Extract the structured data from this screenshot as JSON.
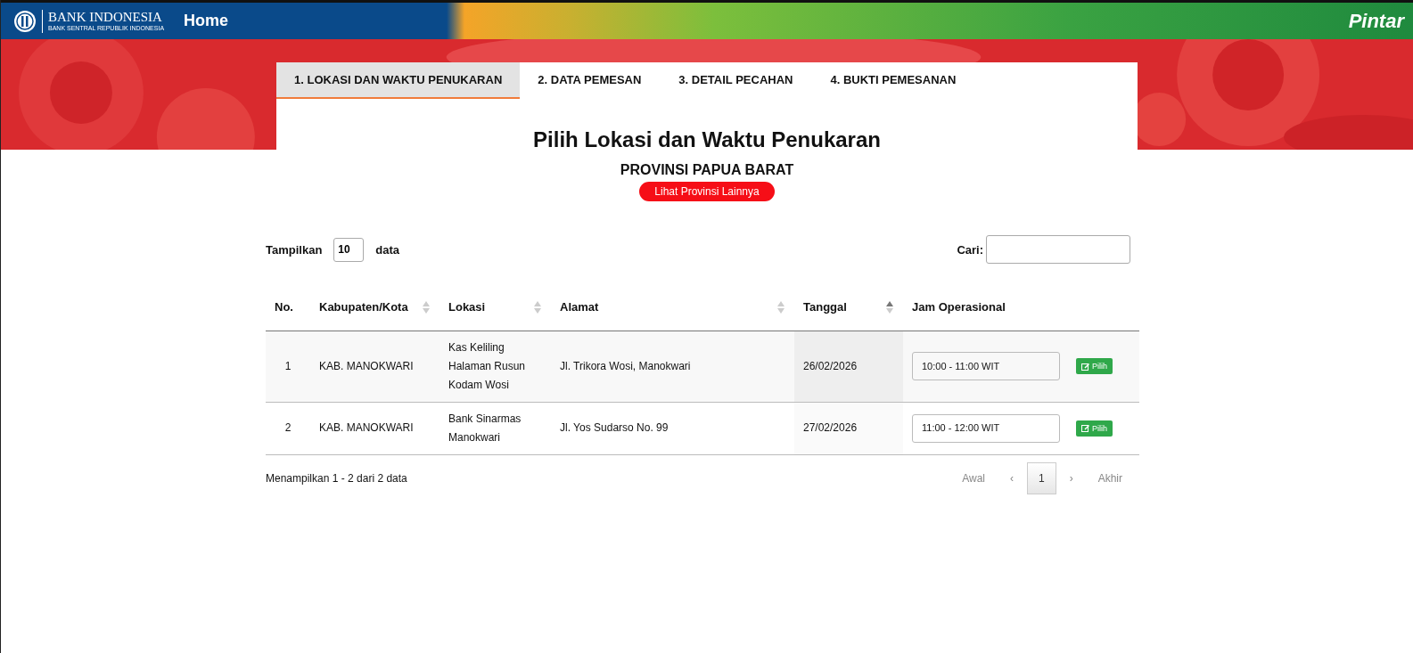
{
  "header": {
    "logo_title": "BANK INDONESIA",
    "logo_subtitle": "BANK SENTRAL REPUBLIK INDONESIA",
    "nav_home": "Home",
    "brand": "Pintar"
  },
  "steps": [
    {
      "label": "1. LOKASI DAN WAKTU PENUKARAN",
      "selected": true
    },
    {
      "label": "2. DATA PEMESAN",
      "selected": false
    },
    {
      "label": "3. DETAIL PECAHAN",
      "selected": false
    },
    {
      "label": "4. BUKTI PEMESANAN",
      "selected": false
    }
  ],
  "title": "Pilih Lokasi dan Waktu Penukaran",
  "province": "PROVINSI PAPUA BARAT",
  "other_province_button": "Lihat Provinsi Lainnya",
  "length_control": {
    "label_before": "Tampilkan",
    "value": "10",
    "label_after": "data"
  },
  "search": {
    "label": "Cari:"
  },
  "table": {
    "columns": [
      {
        "label": "No.",
        "sortable": false
      },
      {
        "label": "Kabupaten/Kota",
        "sortable": true,
        "sorted": false
      },
      {
        "label": "Lokasi",
        "sortable": true,
        "sorted": false
      },
      {
        "label": "Alamat",
        "sortable": true,
        "sorted": false
      },
      {
        "label": "Tanggal",
        "sortable": true,
        "sorted": true
      },
      {
        "label": "Jam Operasional",
        "sortable": false
      }
    ],
    "rows": [
      {
        "no": "1",
        "kabupaten": "KAB. MANOKWARI",
        "lokasi": "Kas Keliling Halaman Rusun Kodam Wosi",
        "alamat": "Jl. Trikora Wosi, Manokwari",
        "tanggal": "26/02/2026",
        "jam": "10:00 - 11:00 WIT",
        "button": "Pilih"
      },
      {
        "no": "2",
        "kabupaten": "KAB. MANOKWARI",
        "lokasi": "Bank Sinarmas Manokwari",
        "alamat": "Jl. Yos Sudarso No. 99",
        "tanggal": "27/02/2026",
        "jam": "11:00 - 12:00 WIT",
        "button": "Pilih"
      }
    ]
  },
  "info": "Menampilkan 1 - 2 dari 2 data",
  "pagination": [
    {
      "label": "Awal",
      "selected": false,
      "disabled": true
    },
    {
      "label": "‹",
      "selected": false,
      "disabled": true
    },
    {
      "label": "1",
      "selected": true,
      "disabled": false
    },
    {
      "label": "›",
      "selected": false,
      "disabled": true
    },
    {
      "label": "Akhir",
      "selected": false,
      "disabled": true
    }
  ]
}
